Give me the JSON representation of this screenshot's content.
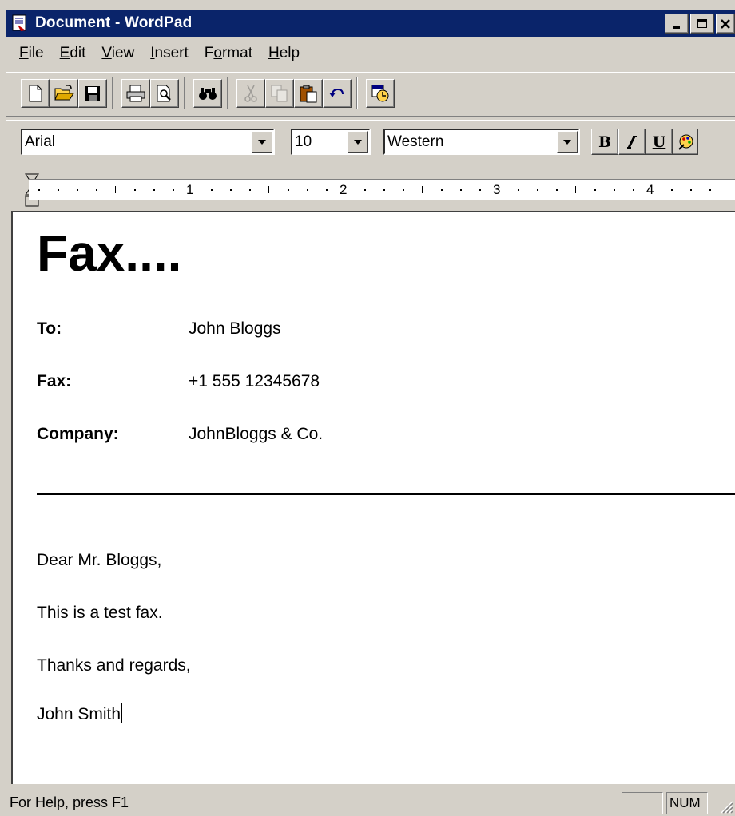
{
  "window": {
    "title": "Document - WordPad",
    "controls": {
      "minimize": "_",
      "maximize": "□",
      "close": "×"
    }
  },
  "menu": [
    "File",
    "Edit",
    "View",
    "Insert",
    "Format",
    "Help"
  ],
  "menu_accel": [
    "F",
    "E",
    "V",
    "I",
    "o",
    "H"
  ],
  "toolbar_icons": [
    "new-icon",
    "open-icon",
    "save-icon",
    "print-icon",
    "print-preview-icon",
    "find-icon",
    "cut-icon",
    "copy-icon",
    "paste-icon",
    "undo-icon",
    "date-time-icon"
  ],
  "format": {
    "font": "Arial",
    "size": "10",
    "script": "Western",
    "bold": "B",
    "italic": "I",
    "underline": "U"
  },
  "ruler": {
    "labels": [
      "1",
      "2",
      "3",
      "4"
    ]
  },
  "document": {
    "title": "Fax....",
    "fields": [
      {
        "label": "To:",
        "value": "John Bloggs"
      },
      {
        "label": "Fax:",
        "value": "+1 555 12345678"
      },
      {
        "label": "Company:",
        "value": "JohnBloggs & Co."
      }
    ],
    "paragraphs": [
      "Dear Mr. Bloggs,",
      "This is a test fax.",
      "Thanks and regards,",
      "John Smith"
    ]
  },
  "status": {
    "help": "For Help, press F1",
    "num": "NUM"
  },
  "colors": {
    "titlebar": "#0a246a",
    "face": "#d4d0c8"
  }
}
